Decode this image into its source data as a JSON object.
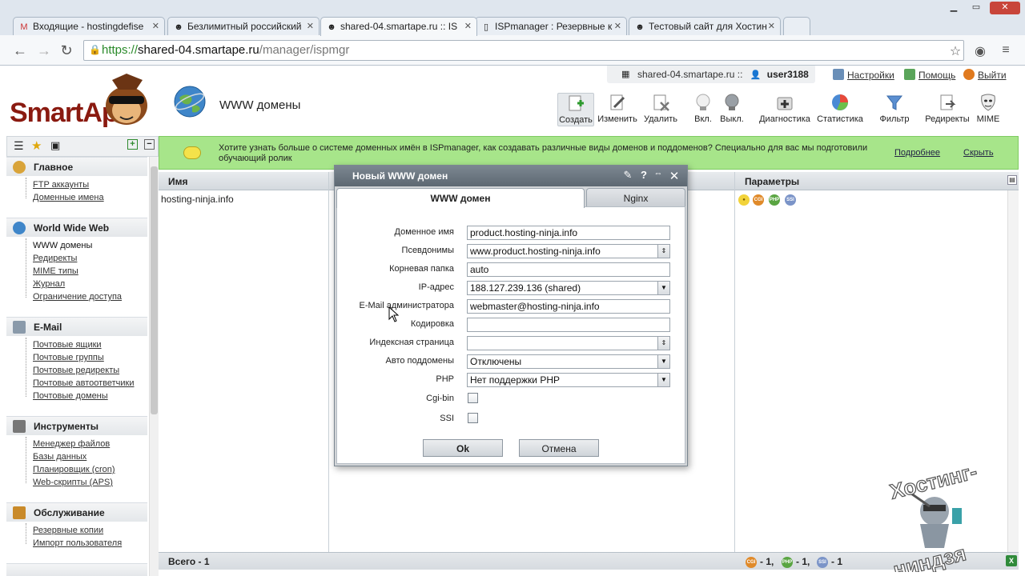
{
  "browser": {
    "tabs": [
      {
        "label": "Входящие - hostingdefise",
        "favicon": "gmail-icon"
      },
      {
        "label": "Безлимитный российский",
        "favicon": "smartape-icon"
      },
      {
        "label": "shared-04.smartape.ru :: IS",
        "favicon": "smartape-icon"
      },
      {
        "label": "ISPmanager : Резервные к",
        "favicon": "page-icon"
      },
      {
        "label": "Тестовый сайт для Хостин",
        "favicon": "smartape-icon"
      }
    ],
    "url": {
      "protocol": "https://",
      "host": "shared-04.smartape.ru",
      "path": "/manager/ispmgr"
    }
  },
  "header": {
    "logo_text": "SmartApe",
    "page_title": "WWW домены",
    "server": "shared-04.smartape.ru ::",
    "user": "user3188",
    "links": {
      "settings": "Настройки",
      "help": "Помощь",
      "logout": "Выйти"
    }
  },
  "toolbar": {
    "create": "Создать",
    "edit": "Изменить",
    "delete": "Удалить",
    "enable": "Вкл.",
    "disable": "Выкл.",
    "diagnostics": "Диагностика",
    "stats": "Статистика",
    "filter": "Фильтр",
    "redirects": "Редиректы",
    "mime": "MIME"
  },
  "sidebar": {
    "groups": [
      {
        "title": "Главное",
        "items": [
          "FTP аккаунты",
          "Доменные имена"
        ]
      },
      {
        "title": "World Wide Web",
        "items": [
          "WWW домены",
          "Редиректы",
          "MIME типы",
          "Журнал",
          "Ограничение доступа"
        ]
      },
      {
        "title": "E-Mail",
        "items": [
          "Почтовые ящики",
          "Почтовые группы",
          "Почтовые редиректы",
          "Почтовые автоответчики",
          "Почтовые домены"
        ]
      },
      {
        "title": "Инструменты",
        "items": [
          "Менеджер файлов",
          "Базы данных",
          "Планировщик (cron)",
          "Web-скрипты (APS)"
        ]
      },
      {
        "title": "Обслуживание",
        "items": [
          "Резервные копии",
          "Импорт пользователя"
        ]
      }
    ]
  },
  "notice": {
    "text": "Хотите узнать больше о системе доменных имён в ISPmanager, как создавать различные виды доменов и поддоменов? Специально для вас мы подготовили обучающий ролик",
    "more": "Подробнее",
    "hide": "Скрыть"
  },
  "table": {
    "columns": {
      "name": "Имя",
      "params": "Параметры"
    },
    "rows": [
      {
        "name": "hosting-ninja.info",
        "params": [
          "lightbulb-icon",
          "CGI",
          "PHP",
          "SSI"
        ]
      }
    ],
    "footer": {
      "total_label": "Всего - 1",
      "cgi_count": "- 1,",
      "php_count": "- 1,",
      "ssi_count": "- 1"
    }
  },
  "dialog": {
    "title": "Новый WWW домен",
    "tabs": [
      "WWW домен",
      "Nginx"
    ],
    "fields": {
      "domain": {
        "label": "Доменное имя",
        "value": "product.hosting-ninja.info"
      },
      "aliases": {
        "label": "Псевдонимы",
        "value": "www.product.hosting-ninja.info"
      },
      "root": {
        "label": "Корневая папка",
        "value": "auto"
      },
      "ip": {
        "label": "IP-адрес",
        "value": "188.127.239.136 (shared)"
      },
      "email": {
        "label": "E-Mail администратора",
        "value": "webmaster@hosting-ninja.info"
      },
      "charset": {
        "label": "Кодировка",
        "value": ""
      },
      "index": {
        "label": "Индексная страница",
        "value": ""
      },
      "autosub": {
        "label": "Авто поддомены",
        "value": "Отключены"
      },
      "php": {
        "label": "PHP",
        "value": "Нет поддержки PHP"
      },
      "cgi": {
        "label": "Cgi-bin",
        "checked": false
      },
      "ssi": {
        "label": "SSI",
        "checked": false
      }
    },
    "ok": "Ok",
    "cancel": "Отмена"
  },
  "watermark": {
    "line1": "Хостинг-",
    "line2": "ниндзя"
  },
  "colors": {
    "notice_bg": "#a7e58a",
    "dialog_title": "#6b7680",
    "logo_red": "#8a1a10"
  }
}
